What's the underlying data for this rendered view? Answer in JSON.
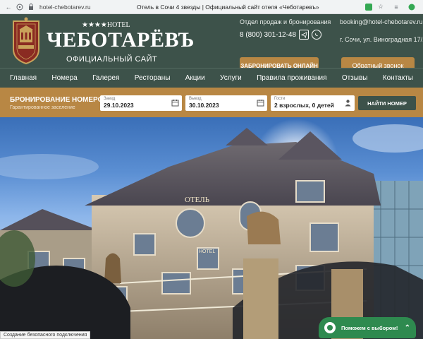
{
  "browser": {
    "url": "hotel-chebotarev.ru",
    "tab_title": "Отель в Сочи 4 звезды | Официальный сайт отеля «Чеботаревъ»"
  },
  "header": {
    "logo_stars": "★★★★HOTEL",
    "logo_name": "ЧЕБОТАРЁВЪ",
    "logo_sub": "ОФИЦИАЛЬНЫЙ САЙТ",
    "sales_label": "Отдел продаж и бронирования",
    "sales_phone": "8 (800) 301-12-48",
    "book_online": "ЗАБРОНИРОВАТЬ ОНЛАЙН",
    "email": "booking@hotel-chebotarev.ru",
    "address": "г. Сочи, ул. Виноградная 17/1",
    "callback": "Обратный звонок"
  },
  "nav": {
    "items": [
      "Главная",
      "Номера",
      "Галерея",
      "Рестораны",
      "Акции",
      "Услуги",
      "Правила проживания",
      "Отзывы",
      "Контакты"
    ]
  },
  "booking": {
    "title": "БРОНИРОВАНИЕ НОМЕРОВ",
    "subtitle": "Гарантированное заселение",
    "checkin_label": "Заезд",
    "checkin_value": "29.10.2023",
    "checkout_label": "Выезд",
    "checkout_value": "30.10.2023",
    "guests_label": "Гости",
    "guests_value": "2 взрослых, 0 детей",
    "find_button": "НАЙТИ НОМЕР"
  },
  "hero": {
    "sign_hotel": "ОТЕЛЬ",
    "sign_small": "HOTEL"
  },
  "status_text": "Создание безопасного подключения",
  "help_widget": {
    "label": "Поможем с выбором!"
  },
  "colors": {
    "header_green": "#3d524a",
    "accent_gold": "#b88744",
    "help_green": "#2e8a4f"
  }
}
